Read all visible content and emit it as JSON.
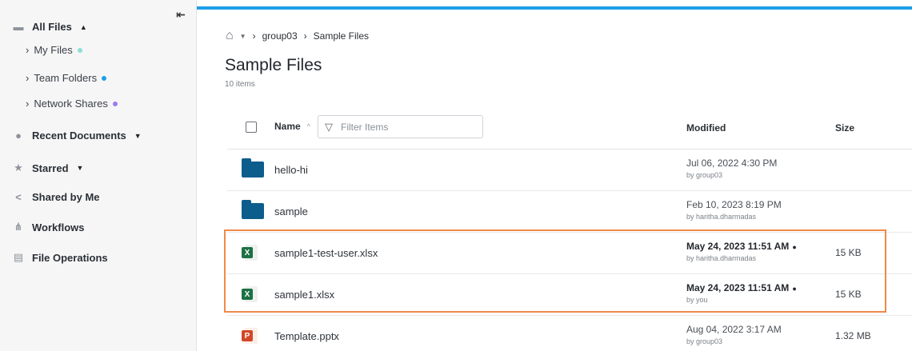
{
  "sidebar": {
    "collapse_icon": "collapse-left-icon",
    "all_files": "All Files",
    "sub_items": [
      {
        "label": "My Files",
        "dot": "#8be0d4"
      },
      {
        "label": "Team Folders",
        "dot": "#1e9fe8"
      },
      {
        "label": "Network Shares",
        "dot": "#9a7cf0"
      }
    ],
    "recent": "Recent Documents",
    "starred": "Starred",
    "shared": "Shared by Me",
    "workflows": "Workflows",
    "file_ops": "File Operations"
  },
  "breadcrumb": {
    "group": "group03",
    "current": "Sample Files"
  },
  "page": {
    "title": "Sample Files",
    "count": "10 items"
  },
  "table": {
    "col_name": "Name",
    "filter_placeholder": "Filter Items",
    "col_modified": "Modified",
    "col_size": "Size",
    "rows": [
      {
        "name": "hello-hi",
        "type": "folder",
        "modified": "Jul 06, 2022 4:30 PM",
        "by": "by group03",
        "size": ""
      },
      {
        "name": "sample",
        "type": "folder",
        "modified": "Feb 10, 2023 8:19 PM",
        "by": "by haritha.dharmadas",
        "size": ""
      },
      {
        "name": "sample1-test-user.xlsx",
        "type": "xlsx",
        "modified": "May 24, 2023 11:51 AM",
        "by": "by haritha.dharmadas",
        "size": "15 KB"
      },
      {
        "name": "sample1.xlsx",
        "type": "xlsx",
        "modified": "May 24, 2023 11:51 AM",
        "by": "by you",
        "size": "15 KB"
      },
      {
        "name": "Template.pptx",
        "type": "pptx",
        "modified": "Aug 04, 2022 3:17 AM",
        "by": "by group03",
        "size": "1.32 MB"
      }
    ]
  },
  "colors": {
    "accent": "#1e9fe8",
    "highlight": "#ef8a4a",
    "folder": "#0d5d8c",
    "excel": "#1d7044",
    "powerpoint": "#d24726"
  }
}
